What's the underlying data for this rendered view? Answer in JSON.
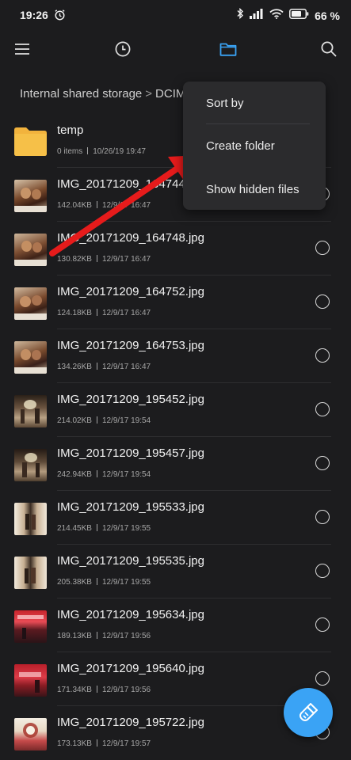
{
  "status_bar": {
    "time": "19:26",
    "battery_text": "66 %",
    "icons": [
      "alarm-icon",
      "bluetooth-icon",
      "signal-icon",
      "wifi-icon",
      "battery-icon"
    ]
  },
  "toolbar": {
    "icons": [
      "menu-icon",
      "recent-clock-icon",
      "folder-icon",
      "search-icon"
    ],
    "active_color": "#3aa3f5"
  },
  "breadcrumb": {
    "root": "Internal shared storage",
    "separator": ">",
    "current": "DCIM"
  },
  "files": [
    {
      "name": "temp",
      "size": "0 items",
      "date": "10/26/19 19:47",
      "type": "folder"
    },
    {
      "name": "IMG_20171209_164744.jpg",
      "size": "142.04KB",
      "date": "12/9/17 16:47",
      "type": "image"
    },
    {
      "name": "IMG_20171209_164748.jpg",
      "size": "130.82KB",
      "date": "12/9/17 16:47",
      "type": "image"
    },
    {
      "name": "IMG_20171209_164752.jpg",
      "size": "124.18KB",
      "date": "12/9/17 16:47",
      "type": "image"
    },
    {
      "name": "IMG_20171209_164753.jpg",
      "size": "134.26KB",
      "date": "12/9/17 16:47",
      "type": "image"
    },
    {
      "name": "IMG_20171209_195452.jpg",
      "size": "214.02KB",
      "date": "12/9/17 19:54",
      "type": "image"
    },
    {
      "name": "IMG_20171209_195457.jpg",
      "size": "242.94KB",
      "date": "12/9/17 19:54",
      "type": "image"
    },
    {
      "name": "IMG_20171209_195533.jpg",
      "size": "214.45KB",
      "date": "12/9/17 19:55",
      "type": "image"
    },
    {
      "name": "IMG_20171209_195535.jpg",
      "size": "205.38KB",
      "date": "12/9/17 19:55",
      "type": "image"
    },
    {
      "name": "IMG_20171209_195634.jpg",
      "size": "189.13KB",
      "date": "12/9/17 19:56",
      "type": "image"
    },
    {
      "name": "IMG_20171209_195640.jpg",
      "size": "171.34KB",
      "date": "12/9/17 19:56",
      "type": "image"
    },
    {
      "name": "IMG_20171209_195722.jpg",
      "size": "173.13KB",
      "date": "12/9/17 19:57",
      "type": "image"
    }
  ],
  "menu": {
    "items": [
      "Sort by",
      "Create folder",
      "Show hidden files"
    ]
  },
  "annotation": {
    "arrow_color": "#e61b1b"
  },
  "fab": {
    "icon": "brush-clean-icon",
    "color": "#3aa3f5"
  }
}
